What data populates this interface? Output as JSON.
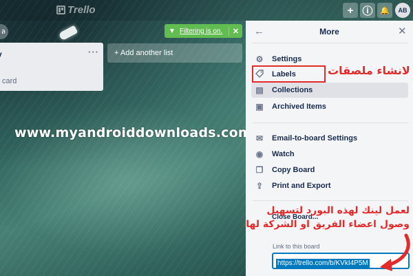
{
  "app": {
    "logo_text": "Trello"
  },
  "header": {
    "buttons": [
      {
        "name": "add-icon",
        "glyph": "+"
      },
      {
        "name": "info-icon",
        "glyph": "ⓘ"
      },
      {
        "name": "bell-icon",
        "glyph": "🔔"
      }
    ],
    "avatar_initials": "AB"
  },
  "board": {
    "member_avatar_glyph": "ล",
    "list": {
      "title": "v",
      "menu_glyph": "···",
      "add_card_label": "card"
    },
    "add_list_label": "+ Add another list",
    "filter": {
      "icon_glyph": "▼",
      "text": "Filtering is on.",
      "close_glyph": "✕"
    }
  },
  "watermark": "www.myandroiddownloads.com",
  "menu": {
    "back_glyph": "←",
    "title": "More",
    "close_glyph": "✕",
    "items_group1": [
      {
        "label": "Settings",
        "icon": "gear-icon",
        "glyph": "⚙"
      },
      {
        "label": "Labels",
        "icon": "tag-icon",
        "glyph": "⌂"
      },
      {
        "label": "Collections",
        "icon": "collections-icon",
        "glyph": "▤",
        "highlighted": true
      },
      {
        "label": "Archived Items",
        "icon": "archive-icon",
        "glyph": "▣"
      }
    ],
    "items_group2": [
      {
        "label": "Email-to-board Settings",
        "icon": "email-icon",
        "glyph": "✉"
      },
      {
        "label": "Watch",
        "icon": "eye-icon",
        "glyph": "◉"
      },
      {
        "label": "Copy Board",
        "icon": "copy-icon",
        "glyph": "❐"
      },
      {
        "label": "Print and Export",
        "icon": "share-icon",
        "glyph": "⇪"
      }
    ],
    "close_board": "Close Board...",
    "link_label": "Link to this board",
    "link_value": "https://trello.com/b/KVkI4P5M"
  },
  "annotations": {
    "labels_note": "لانشاء ملصقات",
    "link_note_line1": "لعمل لينك لهذه البورد لتسهيل",
    "link_note_line2": "وصول اعضاء الفريق او الشركة لها",
    "accent_color": "#e32b2b"
  }
}
